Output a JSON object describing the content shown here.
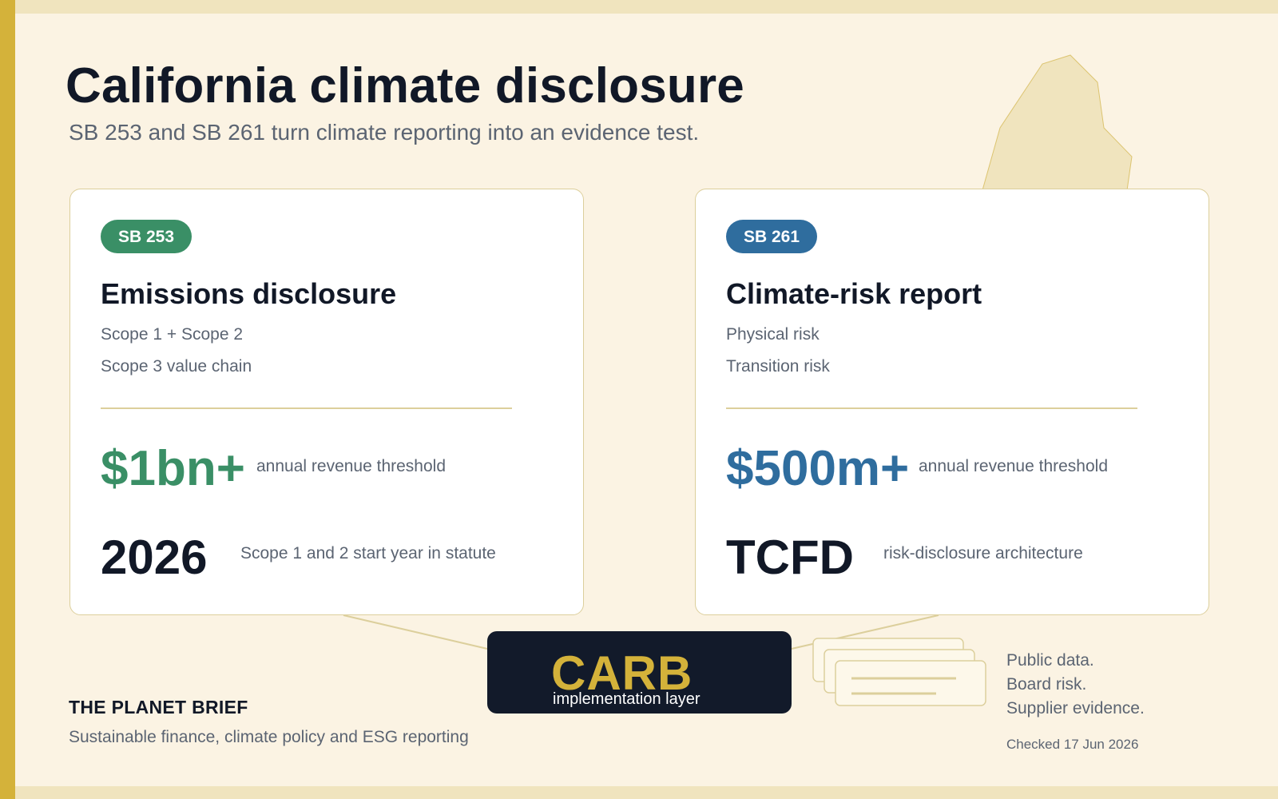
{
  "header": {
    "title": "California climate disclosure",
    "subtitle": "SB 253 and SB 261 turn climate reporting into an evidence test."
  },
  "cards": [
    {
      "badge": "SB 253",
      "title": "Emissions disclosure",
      "bullets": [
        "Scope 1 + Scope 2",
        "Scope 3 value chain"
      ],
      "stat_value": "$1bn+",
      "stat_label": "annual revenue threshold",
      "second_value": "2026",
      "second_label": "Scope 1 and 2 start year in statute",
      "accent_color": "#3A8F66"
    },
    {
      "badge": "SB 261",
      "title": "Climate-risk report",
      "bullets": [
        "Physical risk",
        "Transition risk"
      ],
      "stat_value": "$500m+",
      "stat_label": "annual revenue threshold",
      "second_value": "TCFD",
      "second_label": "risk-disclosure architecture",
      "accent_color": "#2F6D9E"
    }
  ],
  "implementation": {
    "title": "CARB",
    "subtitle": "implementation layer"
  },
  "notes": [
    "Public data.",
    "Board risk.",
    "Supplier evidence."
  ],
  "checked": "Checked 17 Jun 2026",
  "brand": {
    "name": "THE PLANET BRIEF",
    "tagline": "Sustainable finance, climate policy and ESG reporting"
  },
  "icons": {
    "state_shape": "california-outline-icon",
    "documents": "document-stack-icon"
  },
  "colors": {
    "gold": "#D4B23A",
    "navy": "#121A2A",
    "background": "#FBF3E3"
  }
}
